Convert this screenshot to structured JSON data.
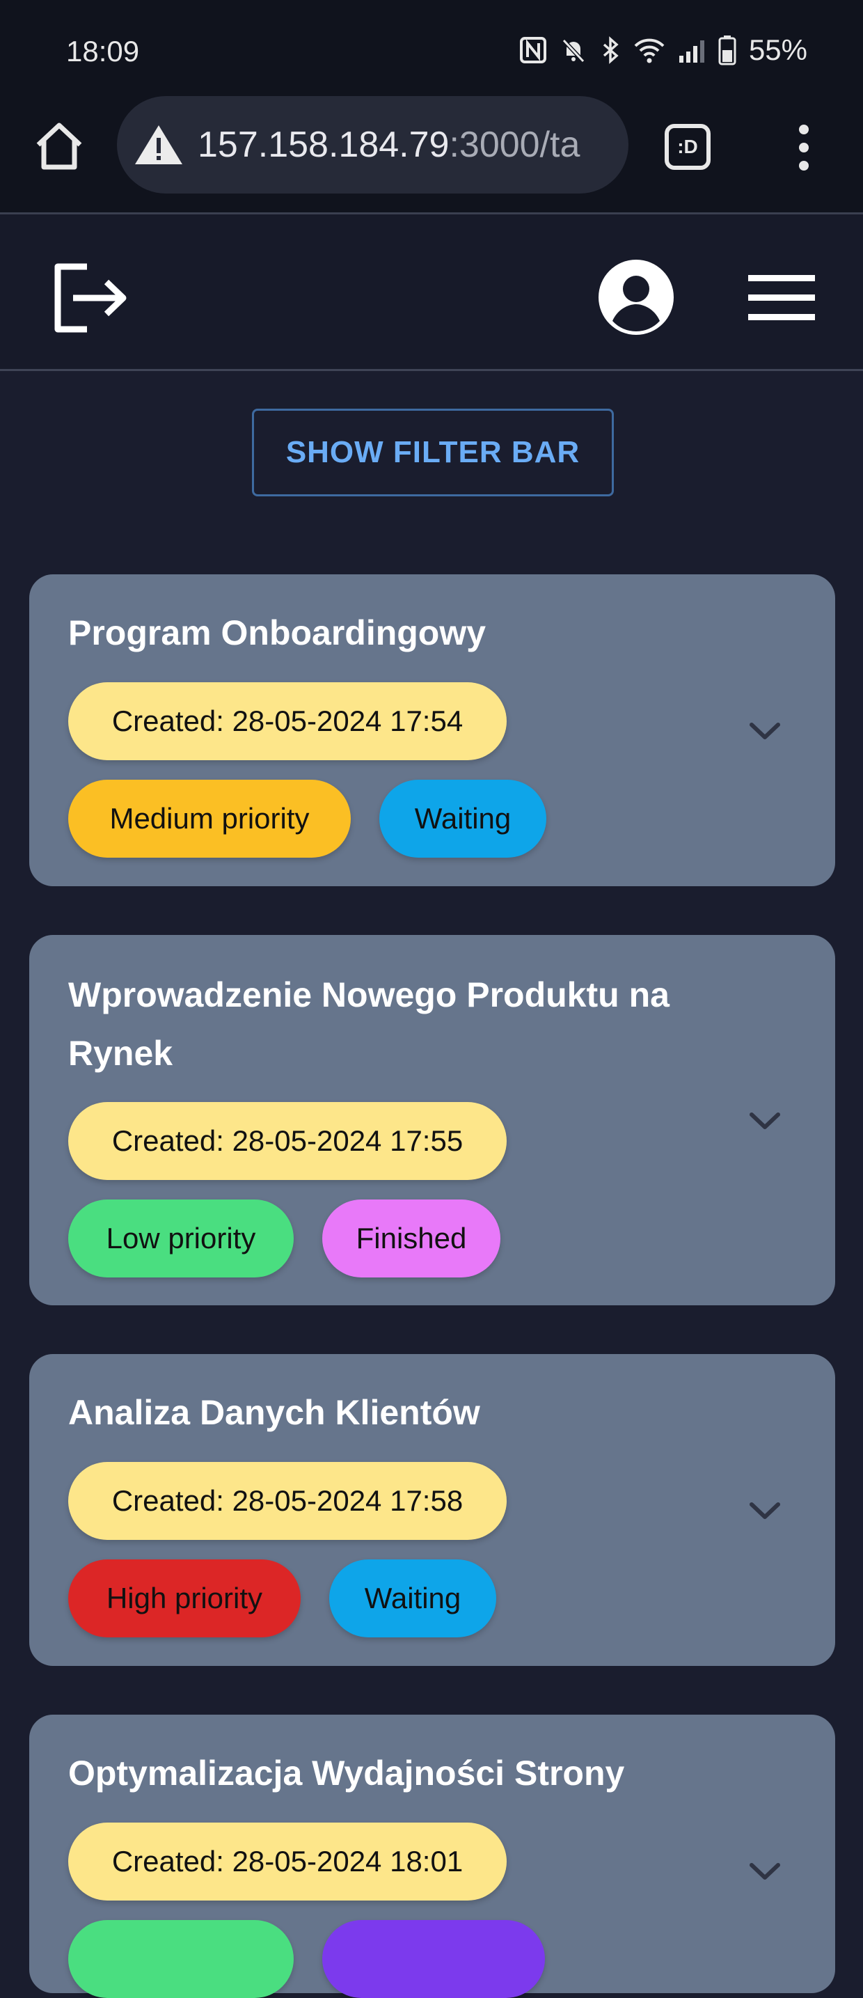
{
  "status_bar": {
    "time": "18:09",
    "battery": "55%",
    "icons": [
      "nfc-icon",
      "mute-icon",
      "bluetooth-icon",
      "wifi-icon",
      "signal-icon",
      "battery-icon"
    ]
  },
  "browser": {
    "url_host": "157.158.184.79",
    "url_rest": ":3000/ta",
    "tab_label": ":D"
  },
  "filter_button": {
    "label": "SHOW FILTER BAR"
  },
  "colors": {
    "card": "#66758c",
    "created": "#fde68a",
    "medium_priority": "#fbbf24",
    "low_priority": "#4ade80",
    "high_priority": "#dc2626",
    "waiting": "#0ea5e9",
    "finished": "#e879f9",
    "partial_second": "#7c3aed"
  },
  "tasks": [
    {
      "title": "Program Onboardingowy",
      "created": "Created: 28-05-2024 17:54",
      "priority": "Medium priority",
      "status": "Waiting"
    },
    {
      "title": "Wprowadzenie Nowego Produktu na Rynek",
      "created": "Created: 28-05-2024 17:55",
      "priority": "Low priority",
      "status": "Finished"
    },
    {
      "title": "Analiza Danych Klientów",
      "created": "Created: 28-05-2024 17:58",
      "priority": "High priority",
      "status": "Waiting"
    },
    {
      "title": "Optymalizacja Wydajności Strony",
      "created": "Created: 28-05-2024 18:01"
    }
  ]
}
